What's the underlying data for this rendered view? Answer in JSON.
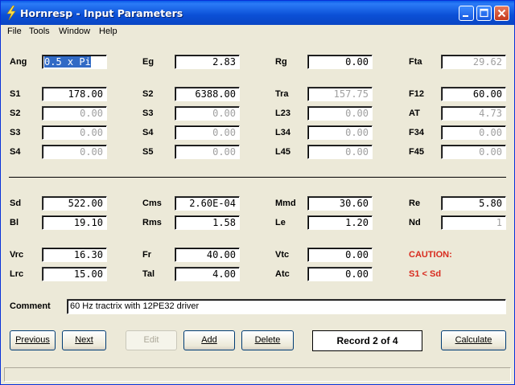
{
  "window": {
    "title": "Hornresp - Input Parameters"
  },
  "menu": [
    "File",
    "Tools",
    "Window",
    "Help"
  ],
  "params": {
    "Ang": "0.5 x Pi",
    "Eg": "2.83",
    "Rg": "0.00",
    "Fta": "29.62",
    "S1": "178.00",
    "S2a": "6388.00",
    "Tra": "157.75",
    "F12": "60.00",
    "S2": "0.00",
    "S3a": "0.00",
    "L23": "0.00",
    "AT": "4.73",
    "S3": "0.00",
    "S4a": "0.00",
    "L34": "0.00",
    "F34": "0.00",
    "S4": "0.00",
    "S5": "0.00",
    "L45": "0.00",
    "F45": "0.00",
    "Sd": "522.00",
    "Cms": "2.60E-04",
    "Mmd": "30.60",
    "Re": "5.80",
    "Bl": "19.10",
    "Rms": "1.58",
    "Le": "1.20",
    "Nd": "1",
    "Vrc": "16.30",
    "Fr": "40.00",
    "Vtc": "0.00",
    "Lrc": "15.00",
    "Tal": "4.00",
    "Atc": "0.00"
  },
  "labels": {
    "Ang": "Ang",
    "Eg": "Eg",
    "Rg": "Rg",
    "Fta": "Fta",
    "S1": "S1",
    "S2a": "S2",
    "Tra": "Tra",
    "F12": "F12",
    "S2": "S2",
    "S3a": "S3",
    "L23": "L23",
    "AT": "AT",
    "S3": "S3",
    "S4a": "S4",
    "L34": "L34",
    "F34": "F34",
    "S4": "S4",
    "S5": "S5",
    "L45": "L45",
    "F45": "F45",
    "Sd": "Sd",
    "Cms": "Cms",
    "Mmd": "Mmd",
    "Re": "Re",
    "Bl": "Bl",
    "Rms": "Rms",
    "Le": "Le",
    "Nd": "Nd",
    "Vrc": "Vrc",
    "Fr": "Fr",
    "Vtc": "Vtc",
    "Lrc": "Lrc",
    "Tal": "Tal",
    "Atc": "Atc",
    "Comment": "Comment"
  },
  "warning": {
    "title": "CAUTION:",
    "message": "S1 < Sd"
  },
  "comment": "60 Hz tractrix with 12PE32 driver",
  "buttons": {
    "previous": "Previous",
    "next": "Next",
    "edit": "Edit",
    "add": "Add",
    "delete": "Delete",
    "calculate": "Calculate"
  },
  "record": "Record 2 of 4",
  "colors": {
    "title_bar": "#0a5be8",
    "warning": "#d82a1e",
    "disabled_text": "#a0a0a0",
    "selection": "#316ac5"
  }
}
